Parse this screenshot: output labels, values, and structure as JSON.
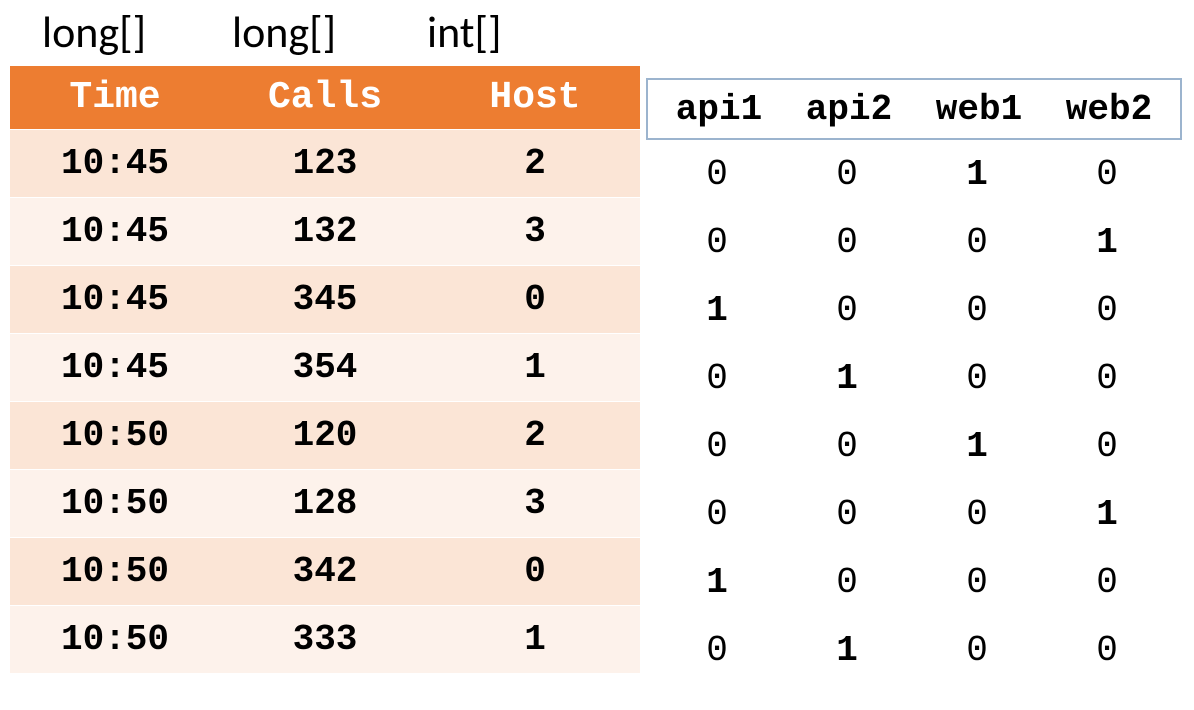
{
  "types": [
    "long[]",
    "long[]",
    "int[]"
  ],
  "left": {
    "headers": [
      "Time",
      "Calls",
      "Host"
    ],
    "rows": [
      {
        "time": "10:45",
        "calls": "123",
        "host": "2"
      },
      {
        "time": "10:45",
        "calls": "132",
        "host": "3"
      },
      {
        "time": "10:45",
        "calls": "345",
        "host": "0"
      },
      {
        "time": "10:45",
        "calls": "354",
        "host": "1"
      },
      {
        "time": "10:50",
        "calls": "120",
        "host": "2"
      },
      {
        "time": "10:50",
        "calls": "128",
        "host": "3"
      },
      {
        "time": "10:50",
        "calls": "342",
        "host": "0"
      },
      {
        "time": "10:50",
        "calls": "333",
        "host": "1"
      }
    ]
  },
  "right": {
    "headers": [
      "api1",
      "api2",
      "web1",
      "web2"
    ],
    "rows": [
      [
        0,
        0,
        1,
        0
      ],
      [
        0,
        0,
        0,
        1
      ],
      [
        1,
        0,
        0,
        0
      ],
      [
        0,
        1,
        0,
        0
      ],
      [
        0,
        0,
        1,
        0
      ],
      [
        0,
        0,
        0,
        1
      ],
      [
        1,
        0,
        0,
        0
      ],
      [
        0,
        1,
        0,
        0
      ]
    ]
  }
}
